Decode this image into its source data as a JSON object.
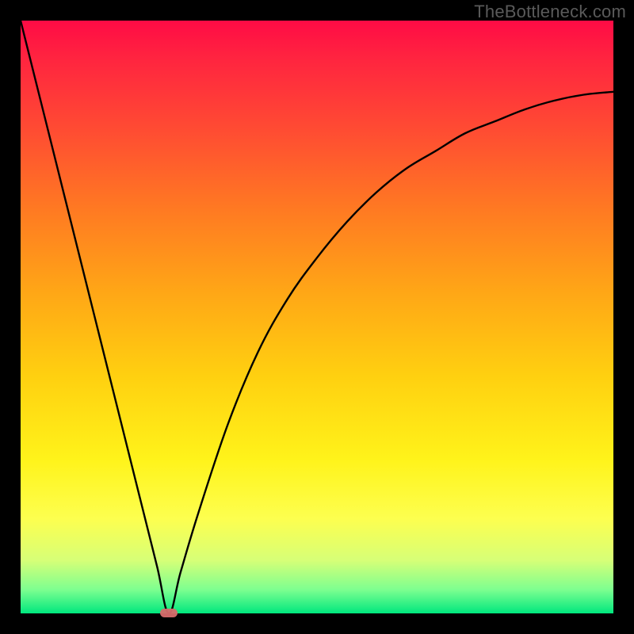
{
  "watermark": {
    "text": "TheBottleneck.com"
  },
  "chart_data": {
    "type": "line",
    "title": "",
    "xlabel": "",
    "ylabel": "",
    "xlim": [
      0,
      100
    ],
    "ylim": [
      0,
      100
    ],
    "grid": false,
    "series": [
      {
        "name": "bottleneck-curve",
        "x": [
          0,
          5,
          10,
          15,
          20,
          23,
          25,
          27,
          30,
          35,
          40,
          45,
          50,
          55,
          60,
          65,
          70,
          75,
          80,
          85,
          90,
          95,
          100
        ],
        "y": [
          100,
          80,
          60,
          40,
          20,
          8,
          0,
          7,
          17,
          32,
          44,
          53,
          60,
          66,
          71,
          75,
          78,
          81,
          83,
          85,
          86.5,
          87.5,
          88
        ]
      }
    ],
    "marker": {
      "x": 25,
      "y": 0,
      "color": "#d76b6b"
    },
    "background_gradient": {
      "top": "#ff0b45",
      "mid": "#ffd010",
      "bottom": "#00e77e"
    }
  }
}
